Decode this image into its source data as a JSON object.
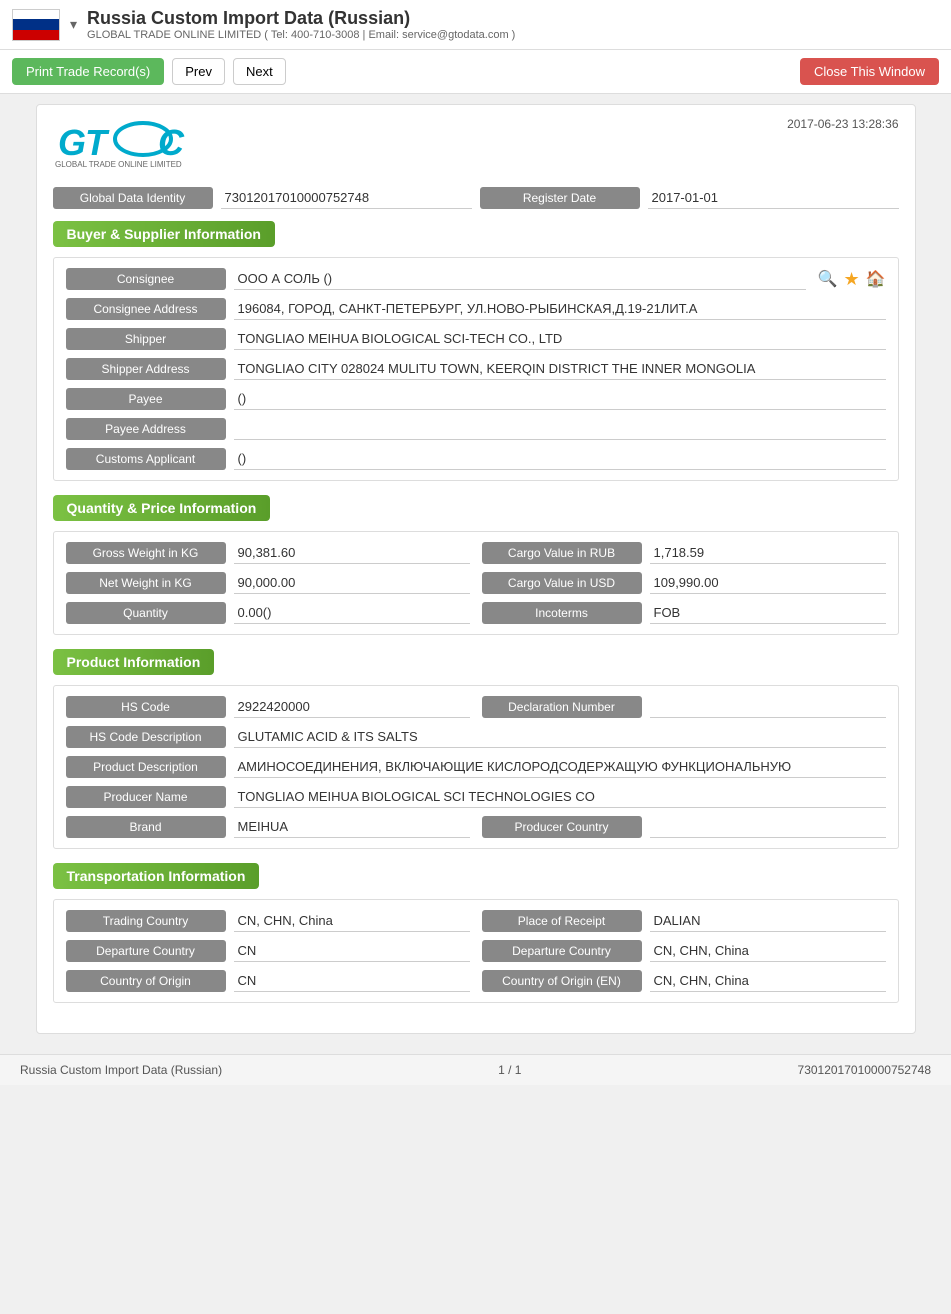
{
  "header": {
    "title": "Russia Custom Import Data (Russian)",
    "subtitle": "GLOBAL TRADE ONLINE LIMITED ( Tel: 400-710-3008 | Email: service@gtodata.com )",
    "dropdown_arrow": "▾"
  },
  "toolbar": {
    "print_label": "Print Trade Record(s)",
    "prev_label": "Prev",
    "next_label": "Next",
    "close_label": "Close This Window"
  },
  "record": {
    "datetime": "2017-06-23 13:28:36",
    "logo_company": "GLOBAL TRADE ONLINE LIMITED",
    "global_data_identity_label": "Global Data Identity",
    "global_data_identity_value": "73012017010000752748",
    "register_date_label": "Register Date",
    "register_date_value": "2017-01-01"
  },
  "buyer_supplier": {
    "section_title": "Buyer & Supplier Information",
    "consignee_label": "Consignee",
    "consignee_value": "ООО А СОЛЬ ()",
    "consignee_address_label": "Consignee Address",
    "consignee_address_value": "196084, ГОРОД, САНКТ-ПЕТЕРБУРГ, УЛ.НОВО-РЫБИНСКАЯ,Д.19-21ЛИТ.А",
    "shipper_label": "Shipper",
    "shipper_value": "TONGLIAO MEIHUA BIOLOGICAL SCI-TECH CO., LTD",
    "shipper_address_label": "Shipper Address",
    "shipper_address_value": "TONGLIAO CITY 028024 MULITU TOWN, KEERQIN DISTRICT THE INNER MONGOLIA",
    "payee_label": "Payee",
    "payee_value": "()",
    "payee_address_label": "Payee Address",
    "payee_address_value": "",
    "customs_applicant_label": "Customs Applicant",
    "customs_applicant_value": "()"
  },
  "quantity_price": {
    "section_title": "Quantity & Price Information",
    "gross_weight_label": "Gross Weight in KG",
    "gross_weight_value": "90,381.60",
    "cargo_value_rub_label": "Cargo Value in RUB",
    "cargo_value_rub_value": "1,718.59",
    "net_weight_label": "Net Weight in KG",
    "net_weight_value": "90,000.00",
    "cargo_value_usd_label": "Cargo Value in USD",
    "cargo_value_usd_value": "109,990.00",
    "quantity_label": "Quantity",
    "quantity_value": "0.00()",
    "incoterms_label": "Incoterms",
    "incoterms_value": "FOB"
  },
  "product": {
    "section_title": "Product Information",
    "hs_code_label": "HS Code",
    "hs_code_value": "2922420000",
    "declaration_number_label": "Declaration Number",
    "declaration_number_value": "",
    "hs_code_desc_label": "HS Code Description",
    "hs_code_desc_value": "GLUTAMIC ACID & ITS SALTS",
    "product_desc_label": "Product Description",
    "product_desc_value": "АМИНОСОЕДИНЕНИЯ, ВКЛЮЧАЮЩИЕ КИСЛОРОДСОДЕРЖАЩУЮ ФУНКЦИОНАЛЬНУЮ",
    "producer_name_label": "Producer Name",
    "producer_name_value": "TONGLIAO MEIHUA BIOLOGICAL SCI TECHNOLOGIES CO",
    "brand_label": "Brand",
    "brand_value": "MEIHUA",
    "producer_country_label": "Producer Country",
    "producer_country_value": ""
  },
  "transportation": {
    "section_title": "Transportation Information",
    "trading_country_label": "Trading Country",
    "trading_country_value": "CN, CHN, China",
    "place_of_receipt_label": "Place of Receipt",
    "place_of_receipt_value": "DALIAN",
    "departure_country_label": "Departure Country",
    "departure_country_value": "CN",
    "departure_country2_label": "Departure Country",
    "departure_country2_value": "CN, CHN, China",
    "country_of_origin_label": "Country of Origin",
    "country_of_origin_value": "CN",
    "country_of_origin_en_label": "Country of Origin (EN)",
    "country_of_origin_en_value": "CN, CHN, China"
  },
  "footer": {
    "left": "Russia Custom Import Data (Russian)",
    "center": "1 / 1",
    "right": "73012017010000752748"
  }
}
